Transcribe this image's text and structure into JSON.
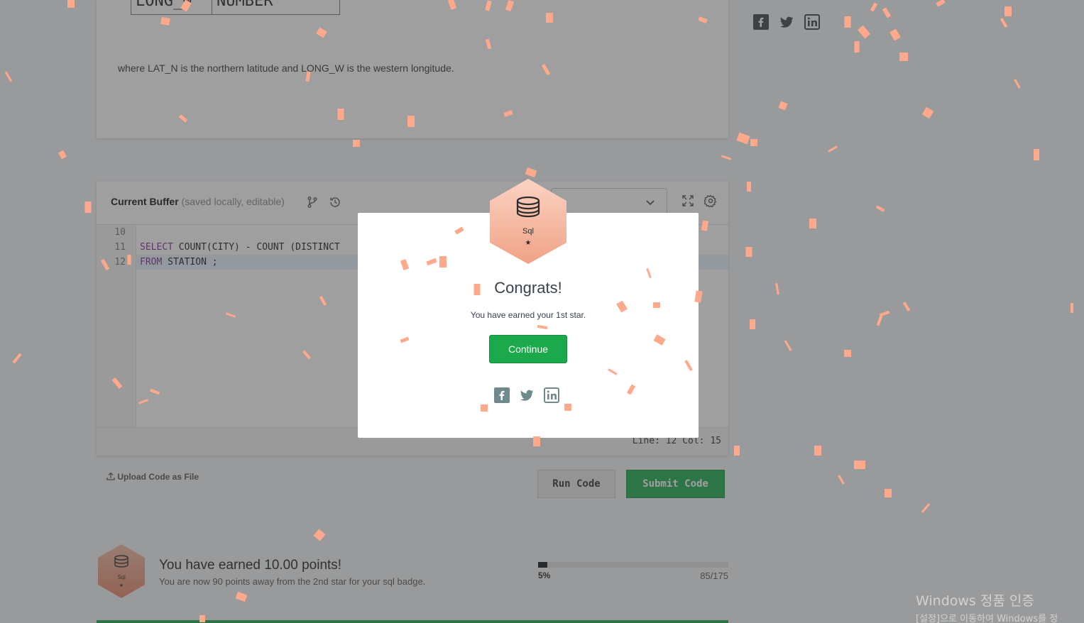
{
  "problem": {
    "schema_rows": [
      {
        "field": "LONG_W",
        "type": "NUMBER"
      }
    ],
    "description": "where LAT_N is the northern latitude and LONG_W is the western longitude."
  },
  "editor": {
    "title": "Current Buffer",
    "subtitle": "(saved locally, editable)",
    "line_numbers": [
      "10",
      "11",
      "12"
    ],
    "code_lines": [
      {
        "text": ""
      },
      {
        "kw1": "SELECT",
        "rest1": " COUNT(CITY) - COUNT (DISTINCT"
      },
      {
        "kw1": "FROM",
        "rest1": " STATION ;"
      }
    ],
    "cursor_status": "Line: 12 Col: 15"
  },
  "actions": {
    "upload_label": "Upload Code as File",
    "run_label": "Run Code",
    "submit_label": "Submit Code"
  },
  "earned": {
    "badge_label": "Sql",
    "title": "You have earned 10.00 points!",
    "subtitle": "You are now 90 points away from the 2nd star for your sql badge.",
    "progress_percent_label": "5%",
    "progress_fraction": 0.05,
    "points_label": "85/175"
  },
  "modal": {
    "badge_label": "Sql",
    "badge_star": "★",
    "title": "Congrats!",
    "subtitle": "You have earned your 1st star.",
    "continue_label": "Continue"
  },
  "watermark": {
    "line1": "Windows 정품 인증",
    "line2": "[설정]으로 이동하여 Windows를 정"
  },
  "colors": {
    "accent_green": "#1ba94c",
    "confetti": "#ffa98c",
    "badge_gradient_top": "#f2b9a6",
    "badge_gradient_bottom": "#e6866a"
  }
}
